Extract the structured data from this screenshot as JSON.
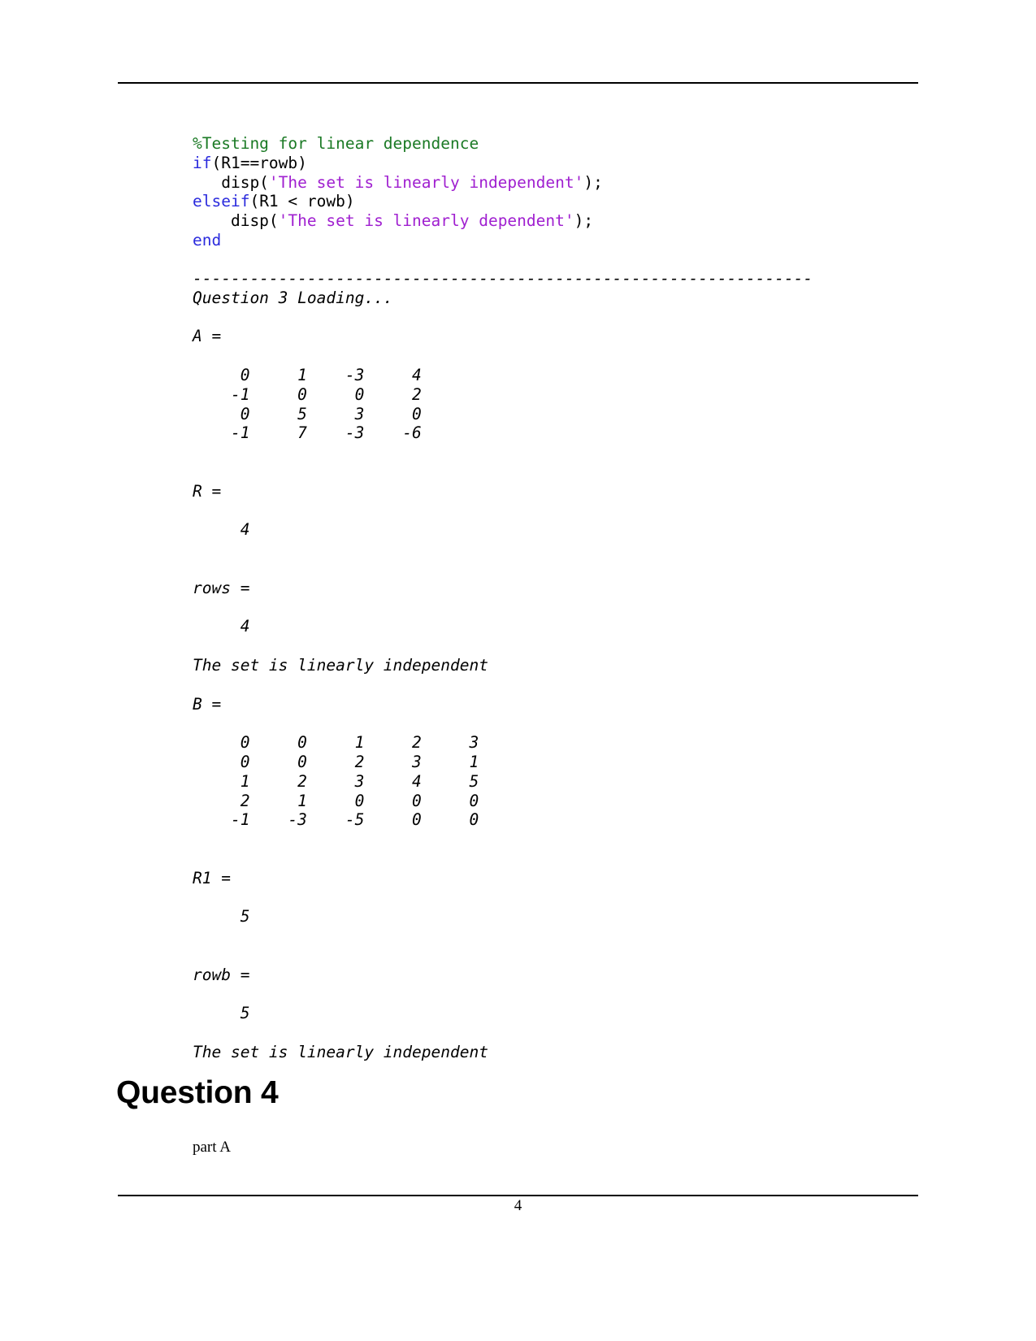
{
  "document": {
    "page_number": "4"
  },
  "code": {
    "lines": [
      [
        {
          "t": "%Testing for linear dependence",
          "c": "comment"
        }
      ],
      [
        {
          "t": "if",
          "c": "keyword"
        },
        {
          "t": "(R1==rowb)",
          "c": "plain"
        }
      ],
      [
        {
          "t": "   disp(",
          "c": "plain"
        },
        {
          "t": "'The set is linearly independent'",
          "c": "string"
        },
        {
          "t": ");",
          "c": "plain"
        }
      ],
      [
        {
          "t": "elseif",
          "c": "keyword"
        },
        {
          "t": "(R1 < rowb)",
          "c": "plain"
        }
      ],
      [
        {
          "t": "    disp(",
          "c": "plain"
        },
        {
          "t": "'The set is linearly dependent'",
          "c": "string"
        },
        {
          "t": ");",
          "c": "plain"
        }
      ],
      [
        {
          "t": "end",
          "c": "keyword"
        }
      ]
    ]
  },
  "output": {
    "lines": [
      "-----------------------------------------------------------------",
      "Question 3 Loading...",
      "",
      "A =",
      "",
      "     0     1    -3     4",
      "    -1     0     0     2",
      "     0     5     3     0",
      "    -1     7    -3    -6",
      "",
      "",
      "R =",
      "",
      "     4",
      "",
      "",
      "rows =",
      "",
      "     4",
      "",
      "The set is linearly independent",
      "",
      "B =",
      "",
      "     0     0     1     2     3",
      "     0     0     2     3     1",
      "     1     2     3     4     5",
      "     2     1     0     0     0",
      "    -1    -3    -5     0     0",
      "",
      "",
      "R1 =",
      "",
      "     5",
      "",
      "",
      "rowb =",
      "",
      "     5",
      "",
      "The set is linearly independent"
    ]
  },
  "section": {
    "heading": "Question 4",
    "paragraph": "part A"
  },
  "colors": {
    "comment": "#1b7a25",
    "keyword": "#2b2bdd",
    "string": "#a020d0",
    "text": "#000000",
    "background": "#ffffff"
  }
}
